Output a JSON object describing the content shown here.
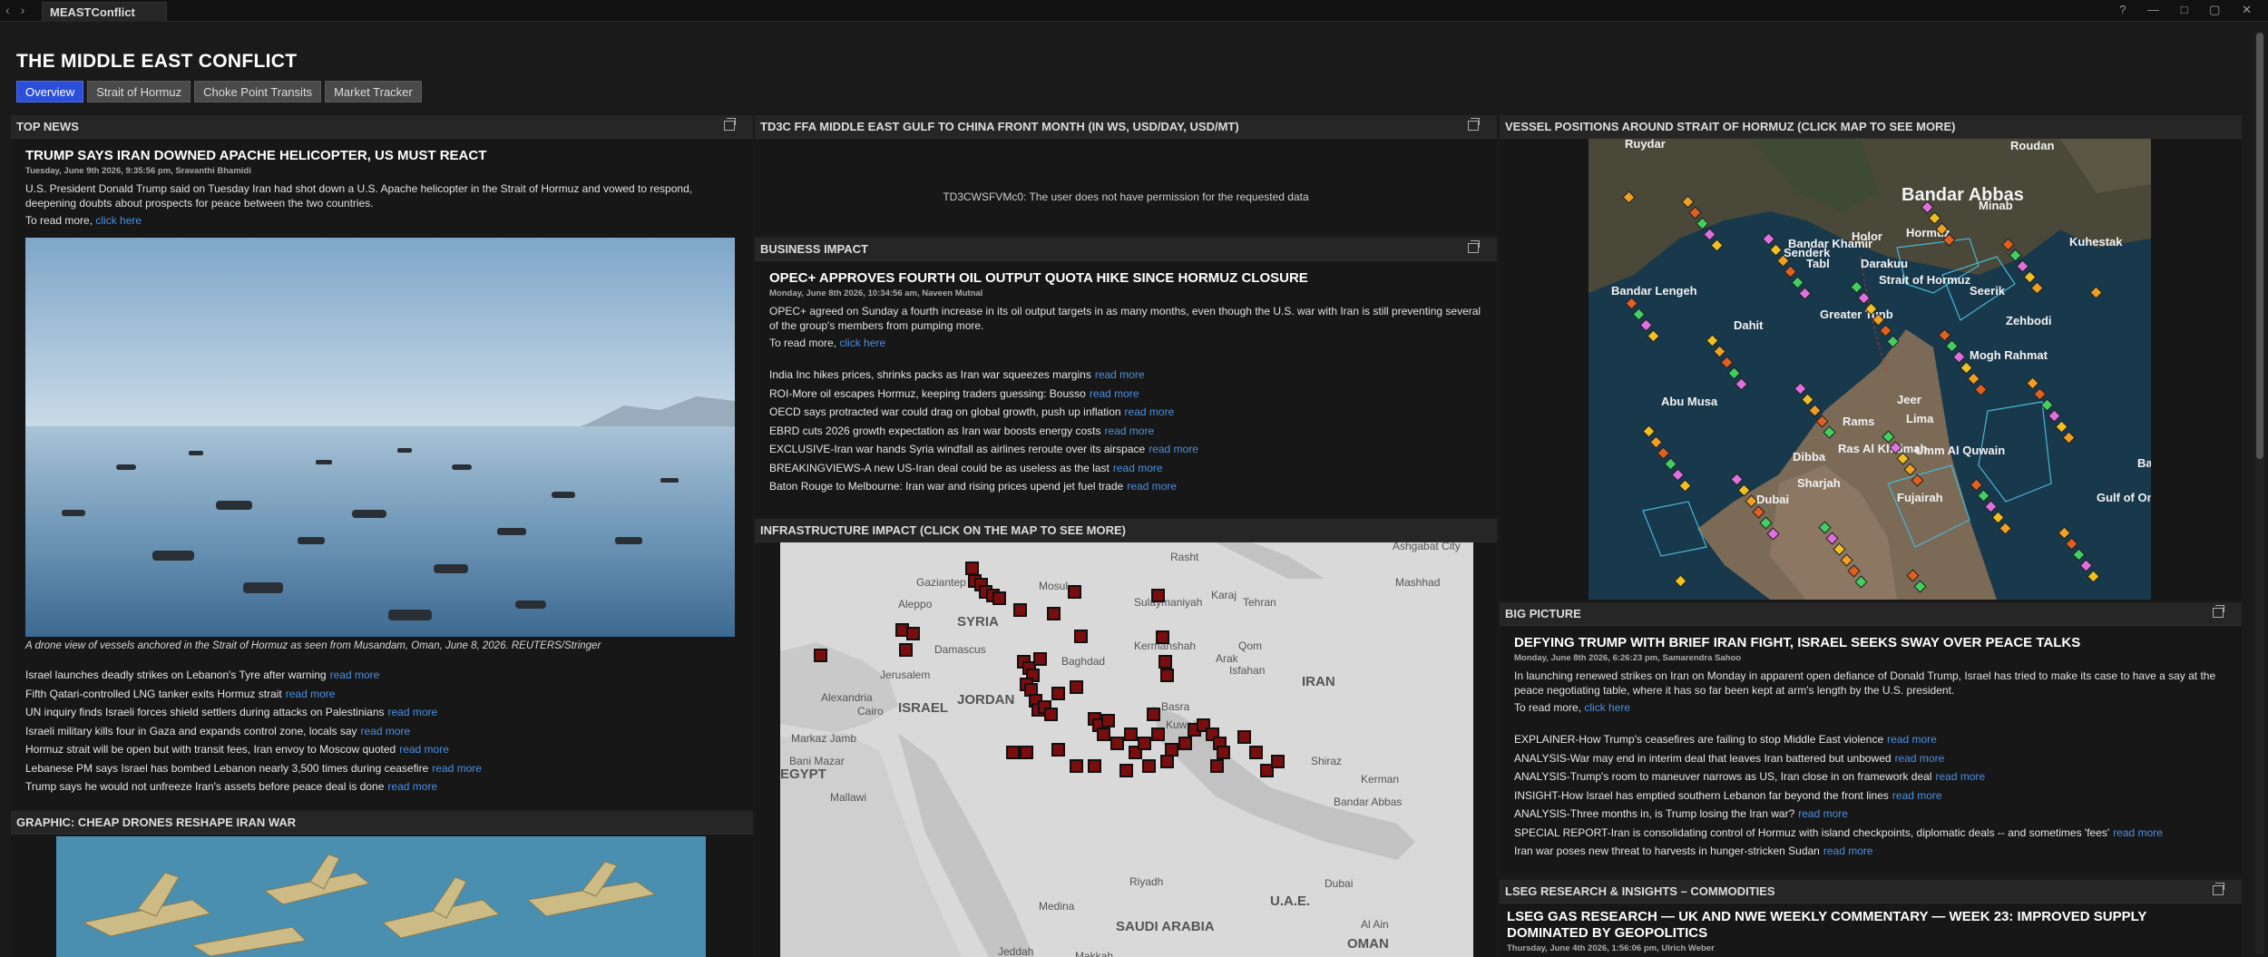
{
  "window": {
    "tab_title": "MEASTConflict",
    "nav_back": "‹",
    "nav_forward": "›",
    "controls": [
      "?",
      "—",
      "□",
      "▢",
      "✕"
    ]
  },
  "page": {
    "title": "THE MIDDLE EAST CONFLICT",
    "tabs": [
      {
        "label": "Overview",
        "active": true
      },
      {
        "label": "Strait of Hormuz"
      },
      {
        "label": "Choke Point Transits"
      },
      {
        "label": "Market Tracker"
      }
    ]
  },
  "top_news": {
    "header": "TOP NEWS",
    "headline": "TRUMP SAYS IRAN DOWNED APACHE HELICOPTER, US MUST REACT",
    "byline": "Tuesday, June 9th 2026, 9:35:56 pm, Sravanthi Bhamidi",
    "summary": "U.S. President Donald Trump said on Tuesday Iran had shot down a U.S. Apache helicopter in the Strait of Hormuz and vowed to respond, deepening doubts about prospects for peace between the two countries.",
    "read_prefix": "To read more,",
    "read_link": "click here",
    "caption": "A drone view of vessels anchored in the Strait of Hormuz as seen from Musandam, Oman, June 8, 2026. REUTERS/Stringer",
    "link_text": "read more",
    "links": [
      "Israel launches deadly strikes on Lebanon's Tyre after warning",
      "Fifth Qatari-controlled LNG tanker exits Hormuz strait",
      "UN inquiry finds Israeli forces shield settlers during attacks on Palestinians",
      "Israeli military kills four in Gaza and expands control zone, locals say",
      "Hormuz strait will be open but with transit fees, Iran envoy to Moscow quoted",
      "Lebanese PM says Israel has bombed Lebanon nearly 3,500 times during ceasefire",
      "Trump says he would not unfreeze Iran's assets before peace deal is done"
    ]
  },
  "graphic": {
    "header": "GRAPHIC: CHEAP DRONES RESHAPE IRAN WAR"
  },
  "td3c": {
    "header": "TD3C FFA MIDDLE EAST GULF TO CHINA FRONT MONTH (IN WS, USD/DAY, USD/MT)",
    "error": "TD3CWSFVMc0: The user does not have permission for the requested data"
  },
  "business": {
    "header": "BUSINESS IMPACT",
    "headline": "OPEC+ APPROVES FOURTH OIL OUTPUT QUOTA HIKE SINCE HORMUZ CLOSURE",
    "byline": "Monday, June 8th 2026, 10:34:56 am, Naveen Mutnal",
    "summary": "OPEC+ agreed on Sunday a fourth increase in its oil output targets in as many months, even though the U.S. war with Iran is still preventing several of the group's members from pumping more.",
    "read_prefix": "To read more,",
    "read_link": "click here",
    "link_text": "read more",
    "links": [
      "India Inc hikes prices, shrinks packs as Iran war squeezes margins",
      "ROI-More oil escapes Hormuz, keeping traders guessing: Bousso",
      "OECD says protracted war could drag on global growth, push up inflation",
      "EBRD cuts 2026 growth expectation as Iran war boosts energy costs",
      "EXCLUSIVE-Iran war hands Syria windfall as airlines reroute over its airspace",
      "BREAKINGVIEWS-A new US-Iran deal could be as useless as the last",
      "Baton Rouge to Melbourne: Iran war and rising prices upend jet fuel trade"
    ]
  },
  "infrastructure": {
    "header": "INFRASTRUCTURE IMPACT (CLICK ON THE MAP TO SEE MORE)",
    "places": [
      "Rasht",
      "Ashgabat City",
      "Tehran",
      "Karaj",
      "Mashhad",
      "Mosul",
      "Gaziantep",
      "Sulaymaniyah",
      "Aleppo",
      "SYRIA",
      "Qom",
      "Kermanshah",
      "Arak",
      "Damascus",
      "Baghdad",
      "Isfahan",
      "IRAN",
      "Jerusalem",
      "JORDAN",
      "ISRAEL",
      "Basra",
      "Kuwait",
      "Shiraz",
      "Alexandria",
      "Cairo",
      "Kerman",
      "Markaz Jamb",
      "Bani Mazar",
      "EGYPT",
      "Mallawi",
      "Bandar Abbas",
      "Riyadh",
      "Dubai",
      "U.A.E.",
      "Al Ain",
      "Medina",
      "SAUDI ARABIA",
      "OMAN",
      "Jeddah",
      "Makkah"
    ]
  },
  "vessels": {
    "header": "VESSEL POSITIONS AROUND STRAIT OF HORMUZ (CLICK MAP TO SEE MORE)",
    "places": [
      "Ruydar",
      "Roudan",
      "Bandar Abbas",
      "Minab",
      "Hormuz",
      "Holor",
      "Bandar Khamir",
      "Kuhestak",
      "Senderk",
      "Tabl",
      "Darakuu",
      "Strait of Hormuz",
      "Seerik",
      "Bandar Lengeh",
      "Greater Tunb",
      "Dahit",
      "Zehbodi",
      "Mogh Rahmat",
      "Abu Musa",
      "Jeer",
      "Rams",
      "Lima",
      "Ras Al Khaimah",
      "Umm Al Quwain",
      "Dibba",
      "Bandar",
      "Sharjah",
      "Dubai",
      "Fujairah",
      "Gulf of Om"
    ]
  },
  "big_picture": {
    "header": "BIG PICTURE",
    "headline": "DEFYING TRUMP WITH BRIEF IRAN FIGHT, ISRAEL SEEKS SWAY OVER PEACE TALKS",
    "byline": "Monday, June 8th 2026, 6:26:23 pm, Samarendra Sahoo",
    "summary": "In launching renewed strikes on Iran on Monday in apparent open defiance of Donald Trump, Israel has tried to make its case to have a say at the peace negotiating table, where it has so far been kept at arm's length by the U.S. president.",
    "read_prefix": "To read more,",
    "read_link": "click here",
    "link_text": "read more",
    "links": [
      "EXPLAINER-How Trump's ceasefires are failing to stop Middle East violence",
      "ANALYSIS-War may end in interim deal that leaves Iran battered but unbowed",
      "ANALYSIS-Trump's room to maneuver narrows as US, Iran close in on framework deal",
      "INSIGHT-How Israel has emptied southern Lebanon far beyond the front lines",
      "ANALYSIS-Three months in, is Trump losing the Iran war?",
      "SPECIAL REPORT-Iran is consolidating control of Hormuz with island checkpoints,  diplomatic deals -- and sometimes 'fees'",
      "Iran war poses new threat to harvests in hunger-stricken Sudan"
    ]
  },
  "lseg": {
    "header": "LSEG RESEARCH & INSIGHTS – COMMODITIES",
    "headline": "LSEG GAS RESEARCH — UK AND NWE WEEKLY COMMENTARY — WEEK 23: IMPROVED SUPPLY DOMINATED BY GEOPOLITICS",
    "byline": "Thursday, June 4th 2026, 1:56:06 pm, Ulrich Weber"
  }
}
